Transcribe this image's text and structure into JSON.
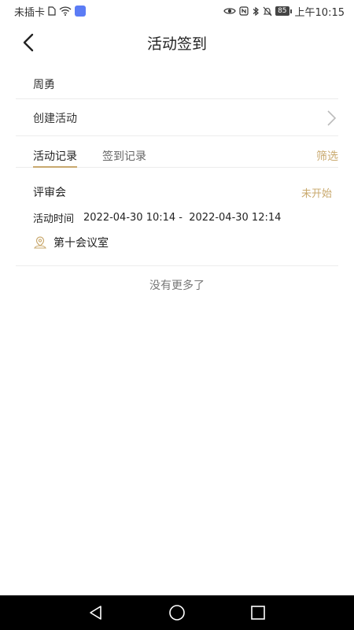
{
  "status_bar": {
    "carrier": "未插卡",
    "battery": "85",
    "time": "上午10:15"
  },
  "header": {
    "title": "活动签到"
  },
  "user": {
    "name": "周勇"
  },
  "create": {
    "label": "创建活动"
  },
  "tabs": {
    "items": [
      {
        "label": "活动记录"
      },
      {
        "label": "签到记录"
      }
    ],
    "filter_label": "筛选"
  },
  "activity": {
    "title": "评审会",
    "status": "未开始",
    "time_label": "活动时间",
    "time_range": "2022-04-30 10:14 -  2022-04-30 12:14",
    "location": "第十会议室"
  },
  "footer": {
    "no_more": "没有更多了"
  },
  "colors": {
    "accent": "#c9a96e",
    "divider": "#ececec",
    "text": "#222222",
    "nav_bg": "#000000"
  }
}
